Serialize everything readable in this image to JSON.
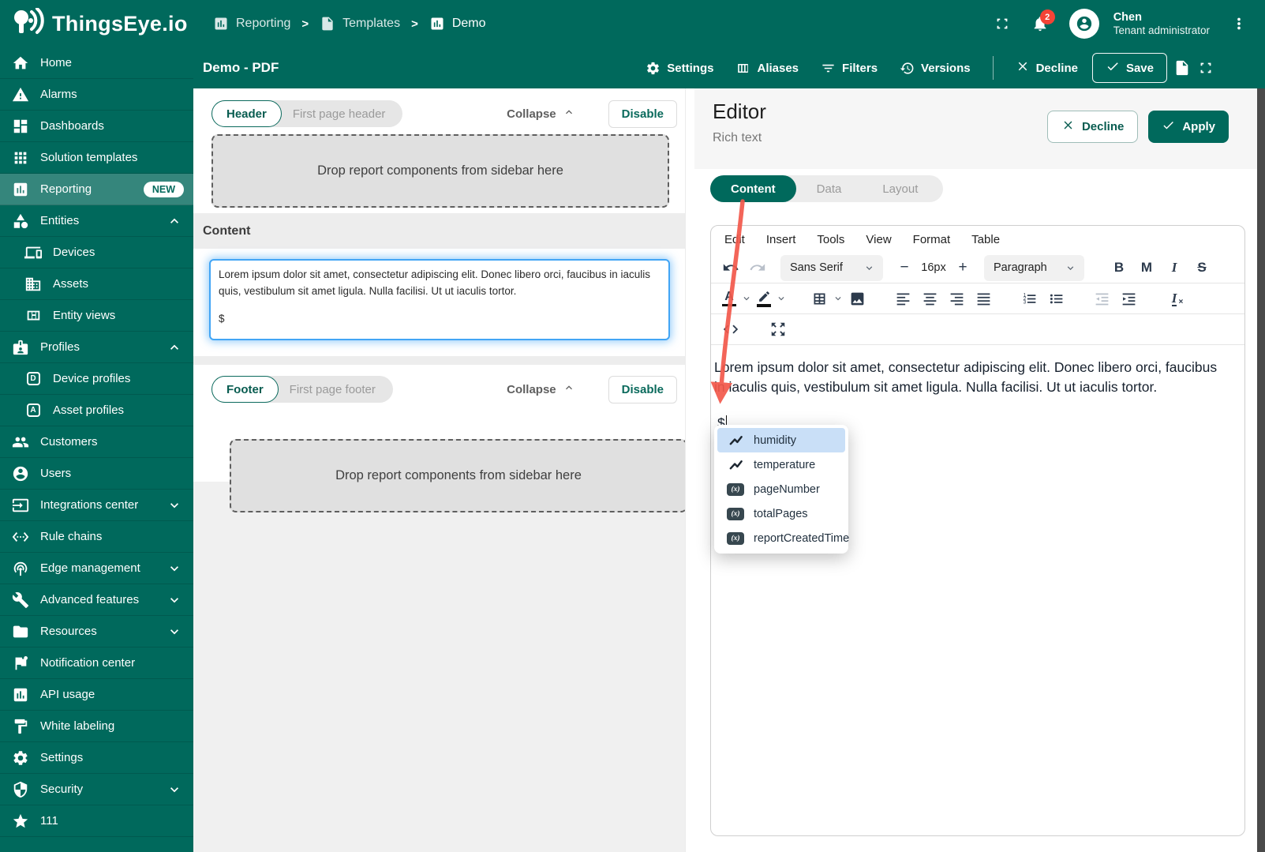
{
  "colors": {
    "primary": "#00695c",
    "sidebar_active": "#35867c",
    "notification_badge": "#f44336",
    "focus_ring": "#42a5f5",
    "arrow": "#f2594b",
    "autocomplete_selected": "#c9dff7"
  },
  "topbar": {
    "brand": "ThingsEye.io",
    "breadcrumb": [
      {
        "label": "Reporting",
        "icon": "chart"
      },
      {
        "label": "Templates",
        "icon": "doc"
      },
      {
        "label": "Demo",
        "icon": "chart"
      }
    ],
    "breadcrumb_separator": ">",
    "notification_count": "2",
    "user": {
      "name": "Chen",
      "role": "Tenant administrator"
    }
  },
  "subbar": {
    "title": "Demo - PDF",
    "actions": [
      {
        "label": "Settings",
        "icon": "gear"
      },
      {
        "label": "Aliases",
        "icon": "columns"
      },
      {
        "label": "Filters",
        "icon": "filter"
      },
      {
        "label": "Versions",
        "icon": "history"
      }
    ],
    "decline_label": "Decline",
    "save_label": "Save"
  },
  "sidebar": {
    "items": [
      {
        "label": "Home",
        "icon": "home"
      },
      {
        "label": "Alarms",
        "icon": "warning"
      },
      {
        "label": "Dashboards",
        "icon": "dashboard"
      },
      {
        "label": "Solution templates",
        "icon": "apps"
      },
      {
        "label": "Reporting",
        "icon": "chart",
        "badge": "NEW",
        "active": true
      },
      {
        "label": "Entities",
        "icon": "category",
        "chevron": "up"
      },
      {
        "label": "Devices",
        "icon": "devices",
        "indent": true
      },
      {
        "label": "Assets",
        "icon": "domain",
        "indent": true
      },
      {
        "label": "Entity views",
        "icon": "view",
        "indent": true
      },
      {
        "label": "Profiles",
        "icon": "badge",
        "chevron": "up"
      },
      {
        "label": "Device profiles",
        "icon": "letter-D",
        "indent": true
      },
      {
        "label": "Asset profiles",
        "icon": "letter-A",
        "indent": true
      },
      {
        "label": "Customers",
        "icon": "people"
      },
      {
        "label": "Users",
        "icon": "person"
      },
      {
        "label": "Integrations center",
        "icon": "input",
        "chevron": "down"
      },
      {
        "label": "Rule chains",
        "icon": "ethernet"
      },
      {
        "label": "Edge management",
        "icon": "wifi",
        "chevron": "down"
      },
      {
        "label": "Advanced features",
        "icon": "build",
        "chevron": "down"
      },
      {
        "label": "Resources",
        "icon": "folder",
        "chevron": "down"
      },
      {
        "label": "Notification center",
        "icon": "flag"
      },
      {
        "label": "API usage",
        "icon": "chart"
      },
      {
        "label": "White labeling",
        "icon": "paint"
      },
      {
        "label": "Settings",
        "icon": "gear"
      },
      {
        "label": "Security",
        "icon": "shield",
        "chevron": "down"
      },
      {
        "label": "111",
        "icon": "star"
      }
    ]
  },
  "main": {
    "header_section": {
      "tag": "Header",
      "subtitle": "First page header",
      "collapse_label": "Collapse",
      "disable_label": "Disable"
    },
    "footer_section": {
      "tag": "Footer",
      "subtitle": "First page footer",
      "collapse_label": "Collapse",
      "disable_label": "Disable"
    },
    "dropzone_text": "Drop report components from sidebar here",
    "content_label": "Content",
    "content_text": "Lorem ipsum dolor sit amet, consectetur adipiscing elit. Donec libero orci, faucibus in iaculis quis, vestibulum sit amet ligula. Nulla facilisi. Ut ut iaculis tortor.",
    "content_token": "$"
  },
  "editor": {
    "title": "Editor",
    "subtitle": "Rich text",
    "decline_label": "Decline",
    "apply_label": "Apply",
    "tabs": [
      {
        "label": "Content",
        "active": true
      },
      {
        "label": "Data"
      },
      {
        "label": "Layout"
      }
    ],
    "menubar": [
      "Edit",
      "Insert",
      "Tools",
      "View",
      "Format",
      "Table"
    ],
    "font_family": "Sans Serif",
    "font_size": "16px",
    "block_format": "Paragraph",
    "size_minus": "−",
    "size_plus": "+",
    "format_buttons": [
      {
        "label": "B",
        "name": "bold-button"
      },
      {
        "label": "M",
        "name": "merge-tag-button"
      },
      {
        "label": "I",
        "name": "italic-button",
        "style": "italic"
      },
      {
        "label": "S",
        "name": "strikethrough-button",
        "style": "strike"
      }
    ],
    "toolbar2": [
      {
        "name": "text-color-button",
        "icon": "colorA",
        "chevron": true
      },
      {
        "name": "highlight-color-button",
        "icon": "pen",
        "chevron": true
      },
      {
        "name": "table-button",
        "icon": "table",
        "chevron": true,
        "gap": true
      },
      {
        "name": "image-button",
        "icon": "image"
      },
      {
        "name": "align-left-button",
        "icon": "alignL",
        "gap": true
      },
      {
        "name": "align-center-button",
        "icon": "alignC"
      },
      {
        "name": "align-right-button",
        "icon": "alignR"
      },
      {
        "name": "align-justify-button",
        "icon": "alignJ"
      },
      {
        "name": "numbered-list-button",
        "icon": "ol",
        "gap": true
      },
      {
        "name": "bullet-list-button",
        "icon": "ul"
      },
      {
        "name": "outdent-button",
        "icon": "outdent",
        "disabled": true,
        "gap": true
      },
      {
        "name": "indent-button",
        "icon": "indent"
      },
      {
        "name": "clear-formatting-button",
        "icon": "clearfmt",
        "gap": true
      }
    ],
    "clear_fmt_glyph": "I",
    "clear_fmt_x": "×",
    "content_paragraph": "Lorem ipsum dolor sit amet, consectetur adipiscing elit. Donec libero orci, faucibus in iaculis quis, vestibulum sit amet ligula. Nulla facilisi. Ut ut iaculis tortor.",
    "token_text": "$",
    "autocomplete": {
      "items": [
        {
          "label": "humidity",
          "icon": "timeseries",
          "selected": true
        },
        {
          "label": "temperature",
          "icon": "timeseries"
        },
        {
          "label": "pageNumber",
          "icon": "function"
        },
        {
          "label": "totalPages",
          "icon": "function"
        },
        {
          "label": "reportCreatedTime",
          "icon": "function"
        }
      ],
      "function_icon_text": "(x)"
    }
  }
}
